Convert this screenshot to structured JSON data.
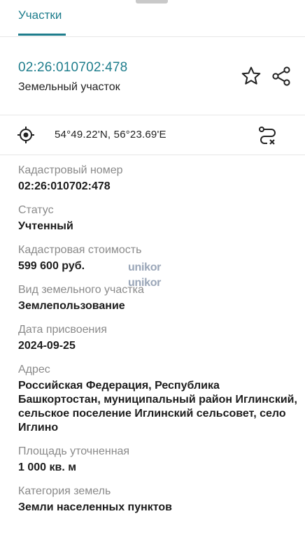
{
  "tabs": {
    "active_label": "Участки"
  },
  "object": {
    "cadastral_id": "02:26:010702:478",
    "type": "Земельный участок"
  },
  "location": {
    "coordinates": "54°49.22'N, 56°23.69'E"
  },
  "watermark": {
    "brand": "unikor"
  },
  "fields": [
    {
      "label": "Кадастровый номер",
      "value": "02:26:010702:478"
    },
    {
      "label": "Статус",
      "value": "Учтенный"
    },
    {
      "label": "Кадастровая стоимость",
      "value": "599 600 руб."
    },
    {
      "label": "Вид земельного участка",
      "value": "Землепользование"
    },
    {
      "label": "Дата присвоения",
      "value": "2024-09-25"
    },
    {
      "label": "Адрес",
      "value": "Российская Федерация, Республика Башкортостан, муниципальный район Иглинский, сельское поселение Иглинский сельсовет, село Иглино"
    },
    {
      "label": "Площадь уточненная",
      "value": "1 000 кв. м"
    },
    {
      "label": "Категория земель",
      "value": "Земли населенных пунктов"
    }
  ],
  "colors": {
    "accent": "#1e7d8c",
    "label": "#8a8a8a",
    "value": "#1c1c1c"
  }
}
